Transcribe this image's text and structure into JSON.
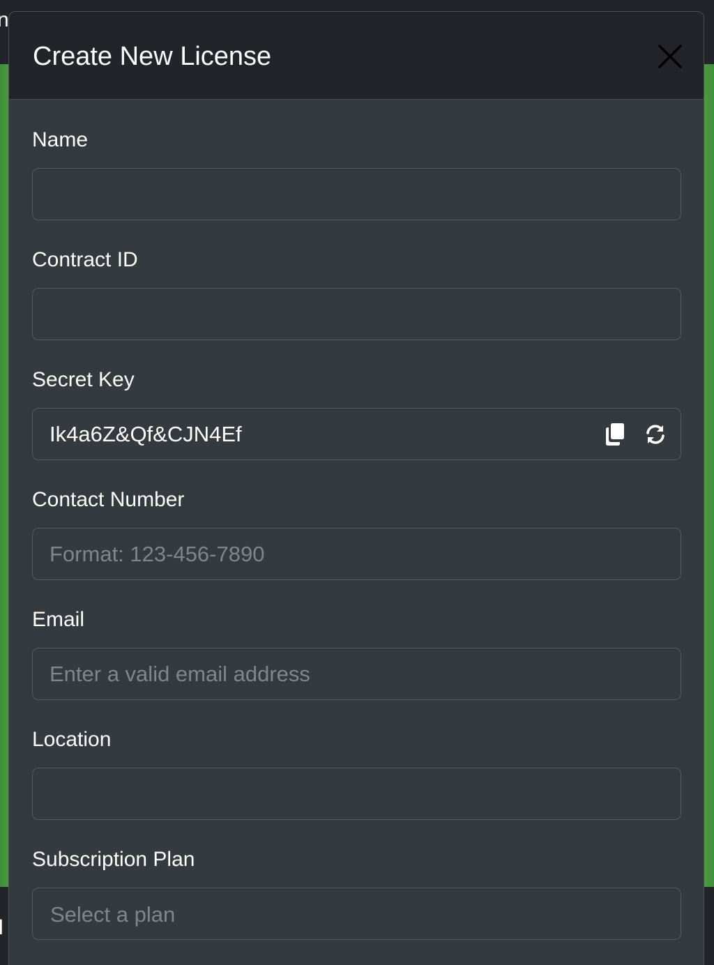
{
  "background": {
    "fragment_top": "n",
    "fragment_bottom": "l"
  },
  "modal": {
    "title": "Create New License",
    "close_icon": "close-icon"
  },
  "form": {
    "name": {
      "label": "Name",
      "value": "",
      "placeholder": ""
    },
    "contract_id": {
      "label": "Contract ID",
      "value": "",
      "placeholder": ""
    },
    "secret_key": {
      "label": "Secret Key",
      "value": "Ik4a6Z&Qf&CJN4Ef",
      "copy_icon": "copy-icon",
      "refresh_icon": "refresh-icon"
    },
    "contact_number": {
      "label": "Contact Number",
      "value": "",
      "placeholder": "Format: 123-456-7890"
    },
    "email": {
      "label": "Email",
      "value": "",
      "placeholder": "Enter a valid email address"
    },
    "location": {
      "label": "Location",
      "value": "",
      "placeholder": ""
    },
    "subscription_plan": {
      "label": "Subscription Plan",
      "selected": "Select a plan"
    }
  },
  "colors": {
    "header_bg": "#212529",
    "body_bg": "#343a40",
    "backdrop_green": "#5aaa4a"
  }
}
